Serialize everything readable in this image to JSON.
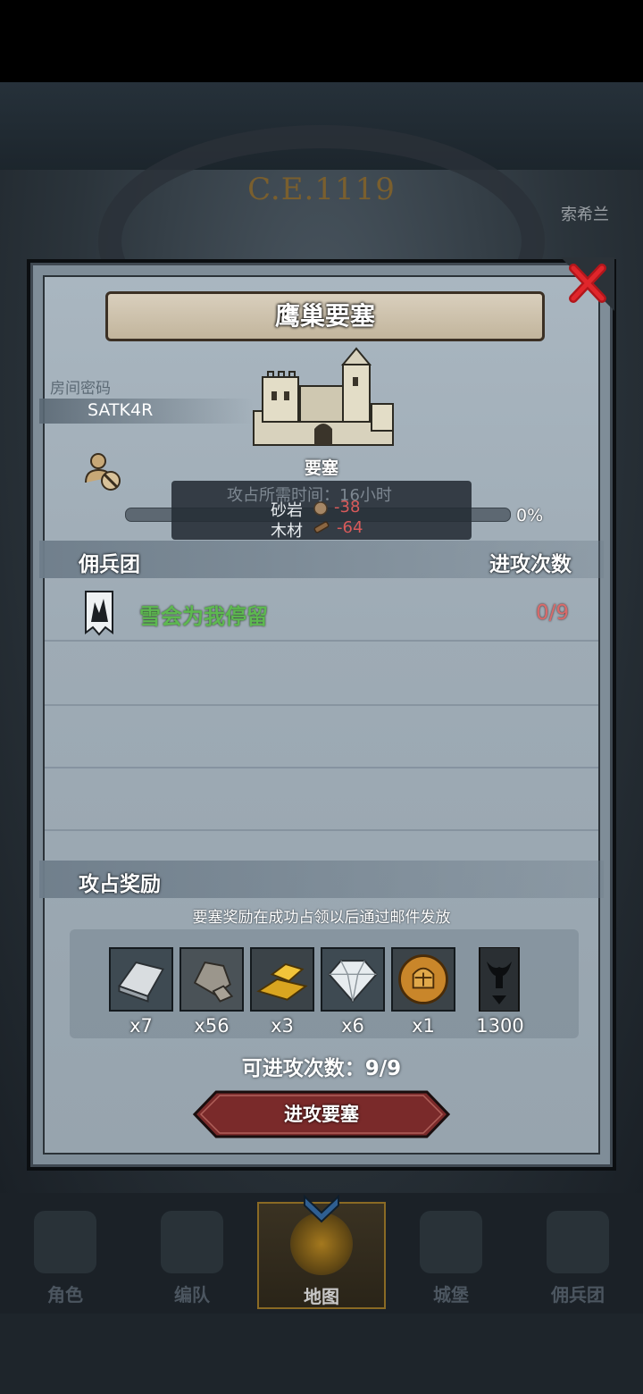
{
  "background": {
    "era_label": "C.E.1119",
    "side_label": "索希兰"
  },
  "dialog": {
    "title": "鹰巢要塞",
    "room": {
      "label": "房间密码",
      "code": "SATK4R"
    },
    "building": {
      "label": "要塞",
      "occupation_percent": "0%"
    },
    "tooltip": {
      "title": "攻占所需时间：16小时",
      "rows": [
        {
          "name": "砂岩",
          "value": "-38"
        },
        {
          "name": "木材",
          "value": "-64"
        }
      ]
    },
    "mercenary_header": "佣兵团",
    "attack_count_header": "进攻次数",
    "teams": [
      {
        "name": "雪会为我停留",
        "count": "0/9"
      }
    ],
    "reward_header": "攻占奖励",
    "reward_note": "要塞奖励在成功占领以后通过邮件发放",
    "rewards": [
      {
        "icon": "iron-ingot-icon",
        "qty": "x7"
      },
      {
        "icon": "stone-ore-icon",
        "qty": "x56"
      },
      {
        "icon": "gold-bars-icon",
        "qty": "x3"
      },
      {
        "icon": "diamond-icon",
        "qty": "x6"
      },
      {
        "icon": "knight-helmet-coin-icon",
        "qty": "x1"
      },
      {
        "icon": "bull-banner-icon",
        "qty": "1300"
      }
    ],
    "attempts_text": "可进攻次数：9/9",
    "attack_button": "进攻要塞"
  },
  "nav": {
    "items": [
      {
        "label": "角色",
        "icon": "knight-icon"
      },
      {
        "label": "编队",
        "icon": "helmet-icon"
      },
      {
        "label": "地图",
        "icon": "globe-map-icon",
        "active": true
      },
      {
        "label": "城堡",
        "icon": "castle-icon"
      },
      {
        "label": "佣兵团",
        "icon": "ship-icon"
      }
    ]
  },
  "colors": {
    "accent_gold": "#8a6a24",
    "team_green": "#5db850",
    "negative_red": "#d85a5a",
    "button_red": "#7a2a2a"
  }
}
